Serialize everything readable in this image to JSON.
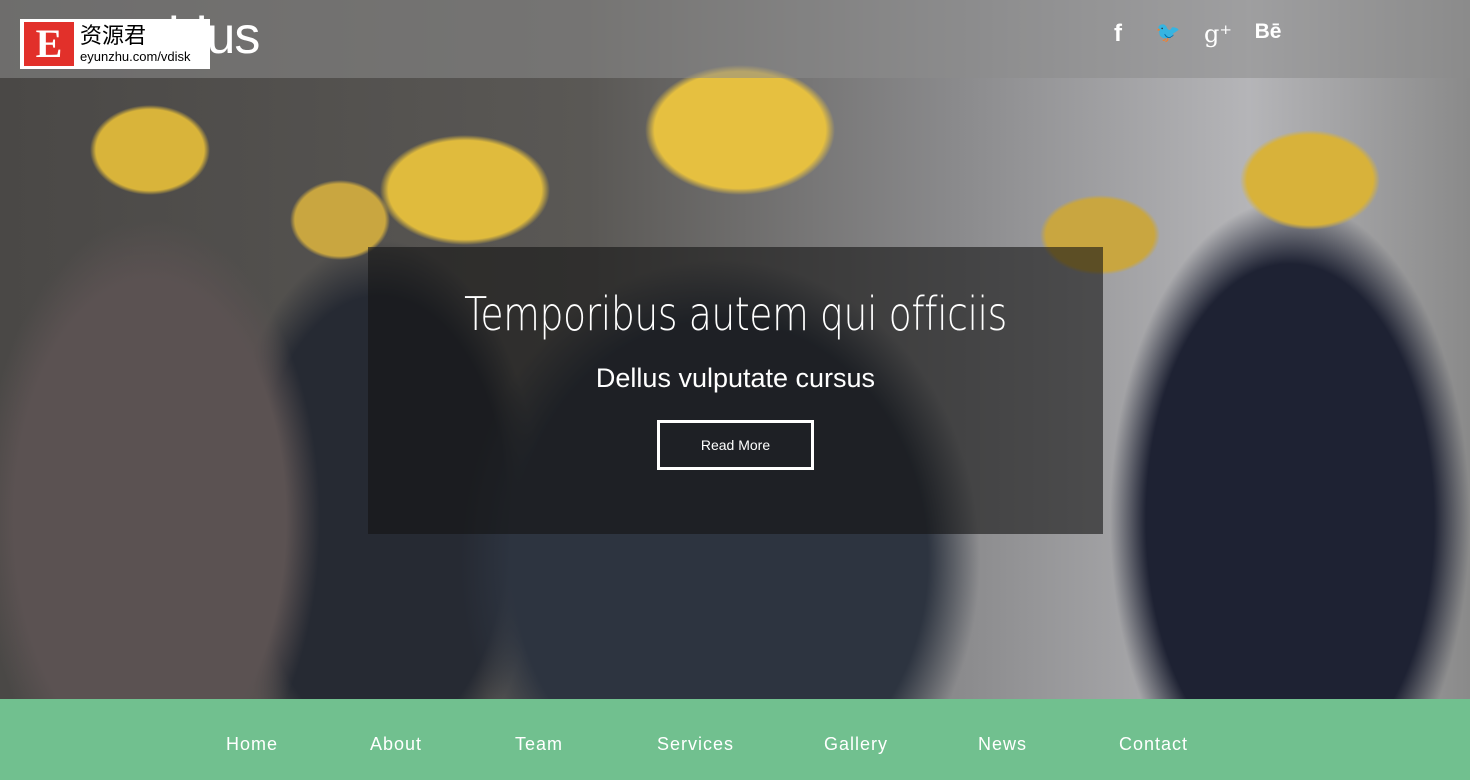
{
  "header": {
    "logo": "ldus",
    "watermark": {
      "letter": "E",
      "cn": "资源君",
      "url": "eyunzhu.com/vdisk"
    },
    "social": [
      {
        "icon": "facebook-icon",
        "glyph": "f"
      },
      {
        "icon": "twitter-icon",
        "glyph": "🐦"
      },
      {
        "icon": "google-plus-icon",
        "glyph": "g⁺"
      },
      {
        "icon": "behance-icon",
        "glyph": "Bē"
      }
    ]
  },
  "hero": {
    "title": "Temporibus autem qui officiis",
    "subtitle": "Dellus vulputate cursus",
    "button": "Read More"
  },
  "nav": {
    "items": [
      "Home",
      "About",
      "Team",
      "Services",
      "Gallery",
      "News",
      "Contact"
    ]
  },
  "colors": {
    "nav": "#71c08f"
  }
}
